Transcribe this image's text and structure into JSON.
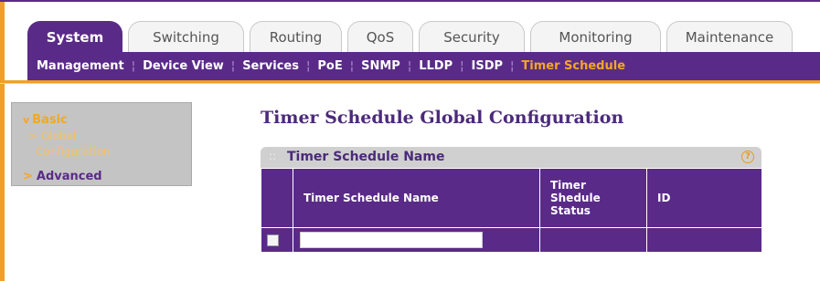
{
  "tabs": [
    {
      "label": "System",
      "active": true
    },
    {
      "label": "Switching"
    },
    {
      "label": "Routing"
    },
    {
      "label": "QoS"
    },
    {
      "label": "Security"
    },
    {
      "label": "Monitoring"
    },
    {
      "label": "Maintenance"
    }
  ],
  "subnav": [
    {
      "label": "Management"
    },
    {
      "label": "Device View"
    },
    {
      "label": "Services"
    },
    {
      "label": "PoE"
    },
    {
      "label": "SNMP"
    },
    {
      "label": "LLDP"
    },
    {
      "label": "ISDP"
    },
    {
      "label": "Timer Schedule",
      "active": true
    }
  ],
  "sidebar": {
    "basic": "Basic",
    "basic_chevron": "v",
    "global_line1": "> Global",
    "global_line2": "Configuration",
    "advanced": "Advanced",
    "advanced_chevron": ">"
  },
  "page_title": "Timer Schedule Global Configuration",
  "panel": {
    "title": "Timer Schedule Name",
    "help": "?",
    "grip": "::",
    "columns": {
      "name": "Timer Schedule Name",
      "status_l1": "Timer",
      "status_l2": "Shedule",
      "status_l3": "Status",
      "id": "ID"
    },
    "row": {
      "name_value": "",
      "status": "",
      "id": ""
    }
  },
  "colors": {
    "accent": "#5a2a88",
    "highlight": "#f5a623",
    "frame": "#f0a028"
  }
}
